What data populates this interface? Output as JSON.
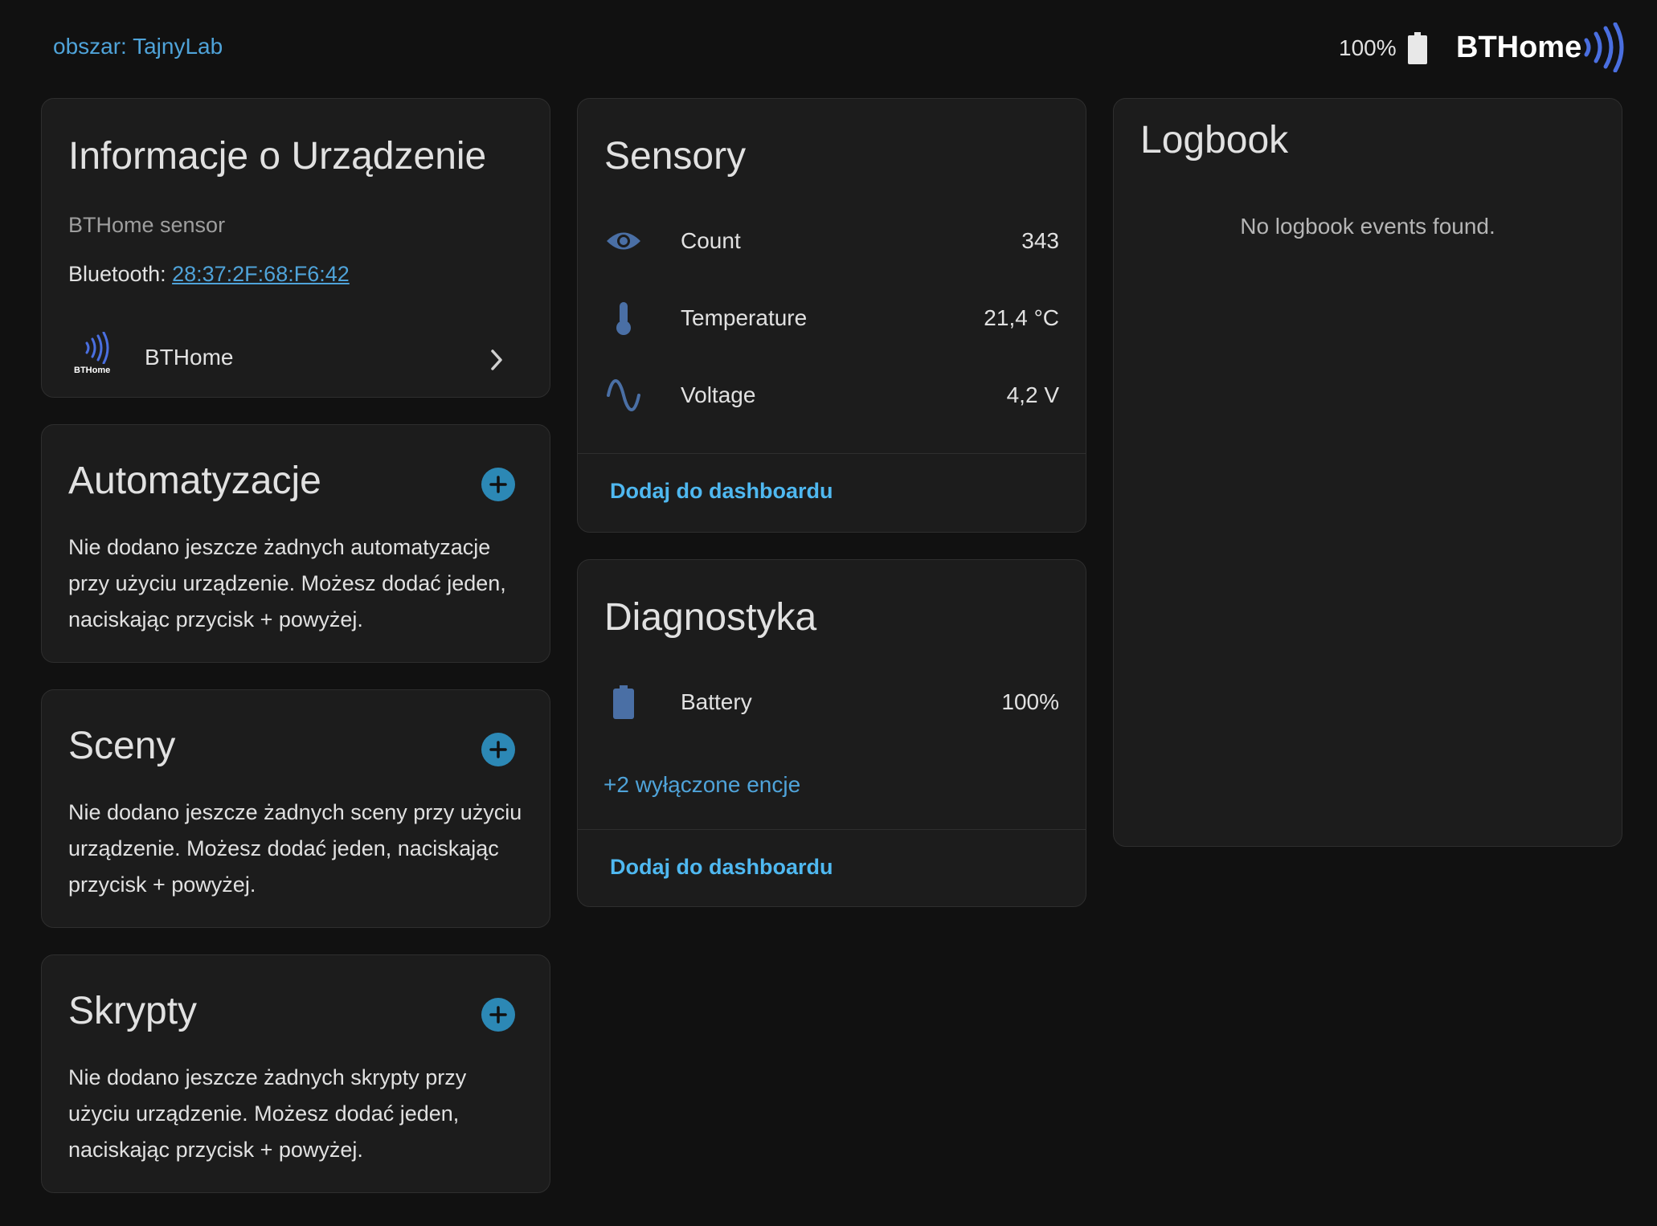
{
  "header": {
    "area_link": "obszar: TajnyLab",
    "battery_label": "100%",
    "brand": "BTHome"
  },
  "device_info": {
    "title": "Informacje o Urządzenie",
    "model": "BTHome sensor",
    "bluetooth_label": "Bluetooth: ",
    "bluetooth_mac": "28:37:2F:68:F6:42",
    "integration_name": "BTHome",
    "integration_logo_text": "BTHome"
  },
  "automations": {
    "title": "Automatyzacje",
    "body": "Nie dodano jeszcze żadnych automatyzacje przy użyciu urządzenie. Możesz dodać jeden, naciskając przycisk + powyżej."
  },
  "scenes": {
    "title": "Sceny",
    "body": "Nie dodano jeszcze żadnych sceny przy użyciu urządzenie. Możesz dodać jeden, naciskając przycisk + powyżej."
  },
  "scripts": {
    "title": "Skrypty",
    "body": "Nie dodano jeszcze żadnych skrypty przy użyciu urządzenie. Możesz dodać jeden, naciskając przycisk + powyżej."
  },
  "sensors": {
    "title": "Sensory",
    "items": [
      {
        "icon": "eye-icon",
        "label": "Count",
        "value": "343"
      },
      {
        "icon": "thermometer-icon",
        "label": "Temperature",
        "value": "21,4 °C"
      },
      {
        "icon": "sine-wave-icon",
        "label": "Voltage",
        "value": "4,2 V"
      }
    ],
    "add_to_dashboard": "Dodaj do dashboardu"
  },
  "diagnostics": {
    "title": "Diagnostyka",
    "items": [
      {
        "icon": "battery-icon",
        "label": "Battery",
        "value": "100%"
      }
    ],
    "disabled_entities": "+2 wyłączone encje",
    "add_to_dashboard": "Dodaj do dashboardu"
  },
  "logbook": {
    "title": "Logbook",
    "empty_text": "No logbook events found."
  },
  "colors": {
    "background": "#111111",
    "card": "#1c1c1c",
    "accent_link": "#4fa3d9",
    "accent_button": "#4fb8f0",
    "add_button": "#2c88b5",
    "icon": "#4a6fa5",
    "brand_waves": "#4a6fe0"
  }
}
